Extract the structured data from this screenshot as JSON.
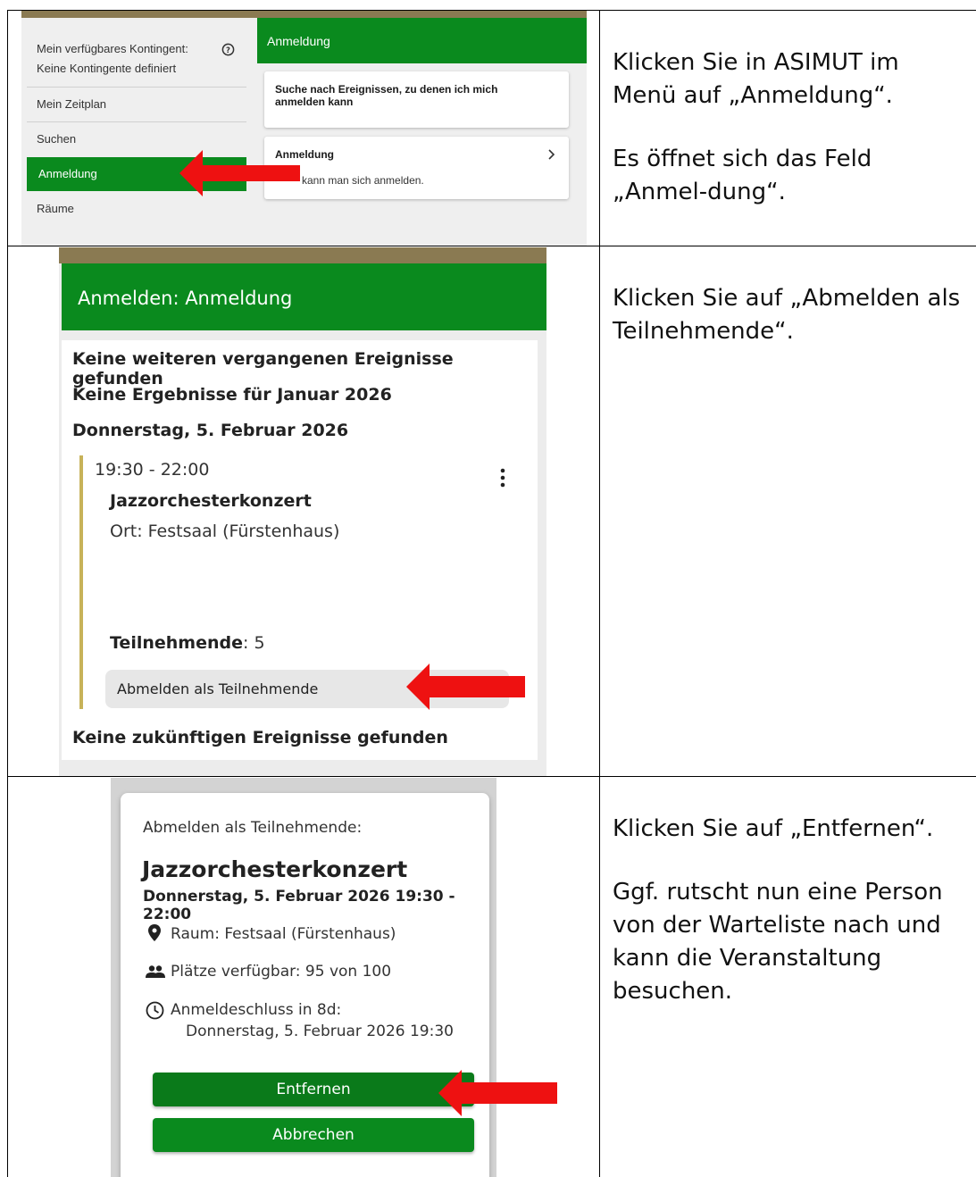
{
  "step1": {
    "screenshot": {
      "quota_label": "Mein verfügbares Kontingent:",
      "quota_value": "Keine Kontingente definiert",
      "menu_items": [
        "Mein Zeitplan",
        "Suchen",
        "Anmeldung",
        "Räume"
      ],
      "panel_title": "Anmeldung",
      "card1_title": "Suche nach Ereignissen, zu denen ich mich anmelden kann",
      "card2_title": "Anmeldung",
      "card2_text": "kann man sich anmelden."
    },
    "instruction": [
      "Klicken Sie in ASIMUT im Menü auf „Anmeldung“.",
      "Es öffnet sich das Feld „Anmel-dung“."
    ]
  },
  "step2": {
    "screenshot": {
      "header": "Anmelden: Anmeldung",
      "no_past": "Keine weiteren vergangenen Ereignisse gefunden",
      "no_results": "Keine Ergebnisse für Januar 2026",
      "date": "Donnerstag, 5. Februar 2026",
      "time": "19:30 - 22:00",
      "event": "Jazzorchesterkonzert",
      "location": "Ort: Festsaal (Fürstenhaus)",
      "participants_label": "Teilnehmende",
      "participants_value": ": 5",
      "unregister_button": "Abmelden als Teilnehmende",
      "no_future": "Keine zukünftigen Ereignisse gefunden"
    },
    "instruction": [
      "Klicken Sie auf „Abmelden als Teilnehmende“."
    ]
  },
  "step3": {
    "screenshot": {
      "dialog_title": "Abmelden als Teilnehmende:",
      "event": "Jazzorchesterkonzert",
      "datetime": "Donnerstag, 5. Februar 2026 19:30 - 22:00",
      "room": "Raum: Festsaal (Fürstenhaus)",
      "seats": "Plätze verfügbar: 95 von 100",
      "deadline_label": "Anmeldeschluss in 8d:",
      "deadline_value": "Donnerstag, 5. Februar 2026 19:30",
      "remove_button": "Entfernen",
      "cancel_button": "Abbrechen"
    },
    "instruction": [
      "Klicken Sie auf „Entfernen“.",
      "Ggf. rutscht nun eine Person von der Warteliste nach und kann die Veranstaltung besuchen."
    ]
  },
  "colors": {
    "primary_green": "#0a8a1e",
    "dark_green": "#0a7a1a",
    "arrow_red": "#ee1111",
    "topbar_brown": "#8a7a52",
    "event_gold": "#c7b259"
  },
  "icons": [
    "help-circle-icon",
    "chevron-right-icon",
    "more-vertical-icon",
    "location-pin-icon",
    "people-icon",
    "clock-icon",
    "red-arrow-icon"
  ]
}
